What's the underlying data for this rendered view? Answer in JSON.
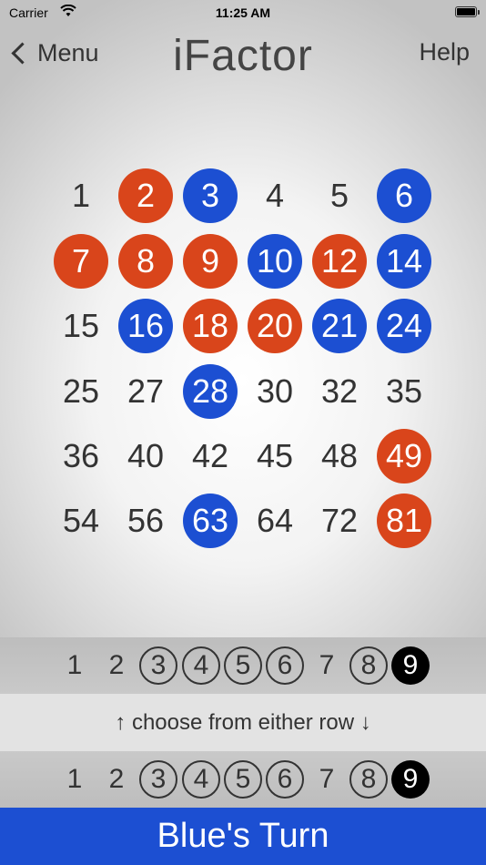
{
  "status_bar": {
    "carrier": "Carrier",
    "time": "11:25 AM"
  },
  "nav": {
    "back_label": "Menu",
    "title": "iFactor",
    "help_label": "Help"
  },
  "board": {
    "rows": [
      [
        {
          "n": "1",
          "owner": "none"
        },
        {
          "n": "2",
          "owner": "red"
        },
        {
          "n": "3",
          "owner": "blue"
        },
        {
          "n": "4",
          "owner": "none"
        },
        {
          "n": "5",
          "owner": "none"
        },
        {
          "n": "6",
          "owner": "blue"
        }
      ],
      [
        {
          "n": "7",
          "owner": "red"
        },
        {
          "n": "8",
          "owner": "red"
        },
        {
          "n": "9",
          "owner": "red"
        },
        {
          "n": "10",
          "owner": "blue"
        },
        {
          "n": "12",
          "owner": "red"
        },
        {
          "n": "14",
          "owner": "blue"
        }
      ],
      [
        {
          "n": "15",
          "owner": "none"
        },
        {
          "n": "16",
          "owner": "blue"
        },
        {
          "n": "18",
          "owner": "red"
        },
        {
          "n": "20",
          "owner": "red"
        },
        {
          "n": "21",
          "owner": "blue"
        },
        {
          "n": "24",
          "owner": "blue"
        }
      ],
      [
        {
          "n": "25",
          "owner": "none"
        },
        {
          "n": "27",
          "owner": "none"
        },
        {
          "n": "28",
          "owner": "blue"
        },
        {
          "n": "30",
          "owner": "none"
        },
        {
          "n": "32",
          "owner": "none"
        },
        {
          "n": "35",
          "owner": "none"
        }
      ],
      [
        {
          "n": "36",
          "owner": "none"
        },
        {
          "n": "40",
          "owner": "none"
        },
        {
          "n": "42",
          "owner": "none"
        },
        {
          "n": "45",
          "owner": "none"
        },
        {
          "n": "48",
          "owner": "none"
        },
        {
          "n": "49",
          "owner": "red"
        }
      ],
      [
        {
          "n": "54",
          "owner": "none"
        },
        {
          "n": "56",
          "owner": "none"
        },
        {
          "n": "63",
          "owner": "blue"
        },
        {
          "n": "64",
          "owner": "none"
        },
        {
          "n": "72",
          "owner": "none"
        },
        {
          "n": "81",
          "owner": "red"
        }
      ]
    ]
  },
  "factor_rows": {
    "top": [
      {
        "n": "1",
        "state": "plain"
      },
      {
        "n": "2",
        "state": "plain"
      },
      {
        "n": "3",
        "state": "circled"
      },
      {
        "n": "4",
        "state": "circled"
      },
      {
        "n": "5",
        "state": "circled"
      },
      {
        "n": "6",
        "state": "circled"
      },
      {
        "n": "7",
        "state": "plain"
      },
      {
        "n": "8",
        "state": "circled"
      },
      {
        "n": "9",
        "state": "selected"
      }
    ],
    "bottom": [
      {
        "n": "1",
        "state": "plain"
      },
      {
        "n": "2",
        "state": "plain"
      },
      {
        "n": "3",
        "state": "circled"
      },
      {
        "n": "4",
        "state": "circled"
      },
      {
        "n": "5",
        "state": "circled"
      },
      {
        "n": "6",
        "state": "circled"
      },
      {
        "n": "7",
        "state": "plain"
      },
      {
        "n": "8",
        "state": "circled"
      },
      {
        "n": "9",
        "state": "selected"
      }
    ]
  },
  "hint": "↑ choose from either row ↓",
  "turn_label": "Blue's Turn",
  "colors": {
    "red": "#d9451b",
    "blue": "#1c4fd2"
  }
}
